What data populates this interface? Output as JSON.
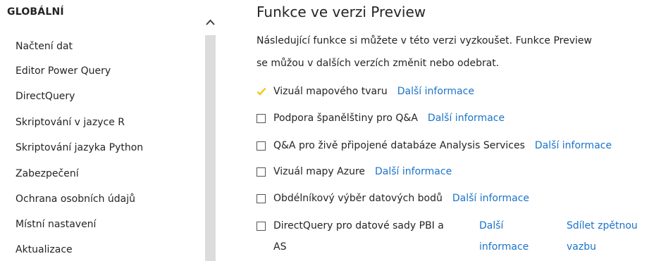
{
  "sidebar": {
    "section_title": "GLOBÁLNÍ",
    "items": [
      {
        "label": "Načtení dat"
      },
      {
        "label": "Editor Power Query"
      },
      {
        "label": "DirectQuery"
      },
      {
        "label": "Skriptování v jazyce R"
      },
      {
        "label": "Skriptování jazyka Python"
      },
      {
        "label": "Zabezpečení"
      },
      {
        "label": "Ochrana osobních údajů"
      },
      {
        "label": "Místní nastavení"
      },
      {
        "label": "Aktualizace"
      }
    ]
  },
  "main": {
    "title": "Funkce ve verzi Preview",
    "description_line1": "Následující funkce si můžete v této verzi vyzkoušet. Funkce Preview",
    "description_line2": "se můžou v dalších verzích změnit nebo odebrat.",
    "options": [
      {
        "label": "Vizuál mapového tvaru",
        "checked": true,
        "link": "Další informace"
      },
      {
        "label": "Podpora španělštiny pro Q&A",
        "checked": false,
        "link": "Další informace"
      },
      {
        "label": "Q&A pro živě připojené databáze Analysis Services",
        "checked": false,
        "link": "Další informace"
      },
      {
        "label": "Vizuál mapy Azure",
        "checked": false,
        "link": "Další informace"
      },
      {
        "label": "Obdélníkový výběr datových bodů",
        "checked": false,
        "link": "Další informace"
      },
      {
        "label_line1": "DirectQuery pro datové sady PBI a",
        "label_line2": "AS",
        "checked": false,
        "link_line1": "Další",
        "link_line2": "informace",
        "feedback_line1": "Sdílet zpětnou",
        "feedback_line2": "vazbu"
      }
    ]
  },
  "colors": {
    "link": "#1a73c9",
    "check": "#f2c811",
    "scroll_thumb": "#dcdcdc"
  }
}
